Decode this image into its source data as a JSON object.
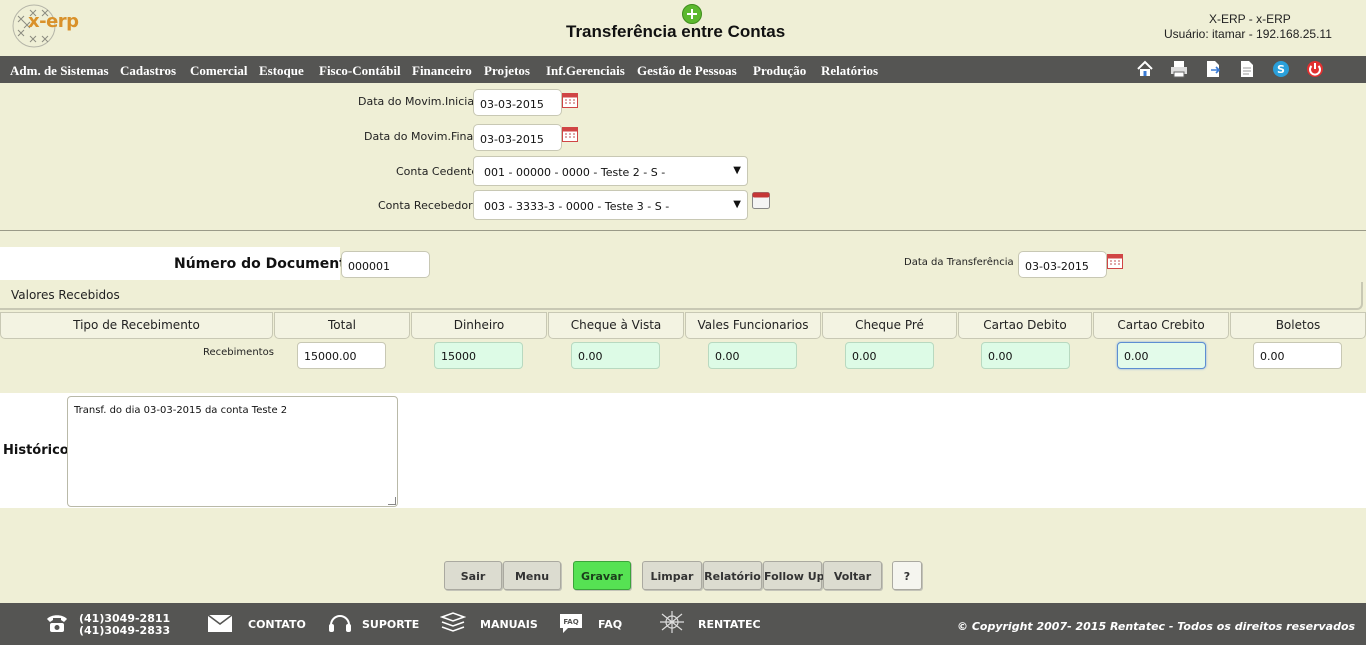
{
  "header": {
    "logo_text": "x-erp",
    "title": "Transferência entre Contas",
    "system_name": "X-ERP - x-ERP",
    "user_info": "Usuário: itamar - 192.168.25.11"
  },
  "nav": {
    "items": [
      "Adm. de Sistemas",
      "Cadastros",
      "Comercial",
      "Estoque",
      "Fisco-Contábil",
      "Financeiro",
      "Projetos",
      "Inf.Gerenciais",
      "Gestão de Pessoas",
      "Produção",
      "Relatórios"
    ],
    "icons": [
      "home-icon",
      "print-icon",
      "export-icon",
      "document-icon",
      "skype-icon",
      "power-icon"
    ]
  },
  "filters": {
    "data_inicial_label": "Data do Movim.Inicial",
    "data_inicial_value": "03-03-2015",
    "data_final_label": "Data do Movim.Final",
    "data_final_value": "03-03-2015",
    "conta_cedente_label": "Conta Cedente",
    "conta_cedente_value": "001 - 00000 - 0000 - Teste 2 - S -",
    "conta_recebedora_label": "Conta Recebedora",
    "conta_recebedora_value": "003 - 3333-3 - 0000 - Teste 3 - S -"
  },
  "document": {
    "numero_label": "Número do Documento",
    "numero_value": "000001",
    "data_transf_label": "Data da Transferência",
    "data_transf_value": "03-03-2015"
  },
  "valores": {
    "section_label": "Valores Recebidos",
    "columns": [
      "Tipo de Recebimento",
      "Total",
      "Dinheiro",
      "Cheque à Vista",
      "Vales Funcionarios",
      "Cheque Pré",
      "Cartao Debito",
      "Cartao Crebito",
      "Boletos"
    ],
    "row_label": "Recebimentos",
    "values": [
      "15000.00",
      "15000",
      "0.00",
      "0.00",
      "0.00",
      "0.00",
      "0.00",
      "0.00"
    ]
  },
  "historico": {
    "label": "Histórico",
    "text": "Transf. do dia 03-03-2015 da conta Teste 2"
  },
  "buttons": {
    "sair": "Sair",
    "menu": "Menu",
    "gravar": "Gravar",
    "limpar": "Limpar",
    "relatorio": "Relatório",
    "followup": "Follow Up",
    "voltar": "Voltar",
    "help": "?"
  },
  "footer": {
    "phone1": "(41)3049-2811",
    "phone2": "(41)3049-2833",
    "contato": "CONTATO",
    "suporte": "SUPORTE",
    "manuais": "MANUAIS",
    "faq": "FAQ",
    "faq_icon_text": "FAQ",
    "rentatec": "RENTATEC",
    "copyright": "© Copyright 2007- 2015 Rentatec - Todos os direitos reservados"
  },
  "colors": {
    "background": "#efefd6",
    "navbar": "#555553",
    "green_button": "#56e253",
    "green_field": "#ddfbe6"
  }
}
